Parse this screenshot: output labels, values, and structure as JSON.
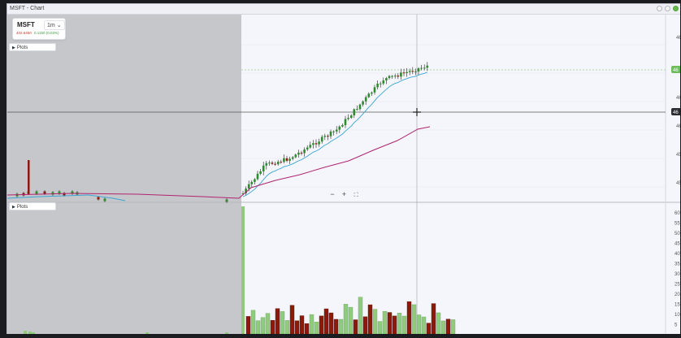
{
  "window": {
    "title": "MSFT - Chart"
  },
  "symbol_box": {
    "symbol": "MSFT",
    "interval": "1m",
    "price": "402.6450",
    "change": "0.1150 (0.03%)"
  },
  "panes": {
    "price_plots_label": "Plots",
    "volume_plots_label": "Plots"
  },
  "zoom": {
    "minus": "−",
    "plus": "+",
    "fit": "⛶"
  },
  "colors": {
    "up": "#2e8b2e",
    "down": "#8b1a0c",
    "vol_up": "#8fcb7b",
    "vol_down": "#8b1a0c",
    "ema_fast": "#3aa6d6",
    "ema_slow": "#b0246f",
    "premarket_shade": "#c6c7cb",
    "last_price_tag": "#6dbd5a"
  },
  "price_axis_labels": [
    "46",
    "46",
    "46",
    "46",
    "45",
    "45"
  ],
  "volume_axis_labels": [
    "60",
    "55",
    "50",
    "45",
    "40",
    "35",
    "30",
    "25",
    "20",
    "15",
    "10",
    "5"
  ],
  "crosshair_label": "46",
  "last_price_label": "46"
}
